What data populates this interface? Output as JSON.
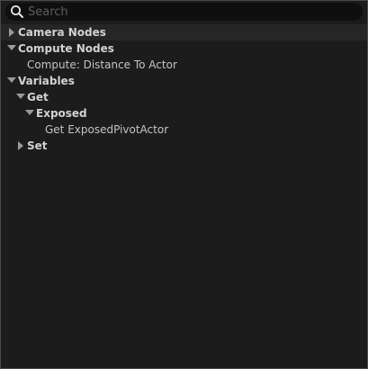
{
  "search": {
    "placeholder": "Search",
    "value": ""
  },
  "tree": {
    "camera_nodes": {
      "label": "Camera Nodes",
      "expanded": false
    },
    "compute_nodes": {
      "label": "Compute Nodes",
      "expanded": true,
      "items": [
        {
          "label": "Compute: Distance To Actor"
        }
      ]
    },
    "variables": {
      "label": "Variables",
      "expanded": true,
      "get": {
        "label": "Get",
        "expanded": true,
        "exposed": {
          "label": "Exposed",
          "expanded": true,
          "items": [
            {
              "label": "Get ExposedPivotActor"
            }
          ]
        }
      },
      "set": {
        "label": "Set",
        "expanded": false
      }
    }
  },
  "colors": {
    "background": "#1c1c1c",
    "search_bg": "#0f0f0f",
    "text": "#cfcfcf",
    "arrow": "#9a9a9a",
    "border": "#4a4a4a"
  },
  "icons": {
    "search": "search-icon",
    "collapsed": "triangle-right-icon",
    "expanded": "triangle-down-icon"
  }
}
